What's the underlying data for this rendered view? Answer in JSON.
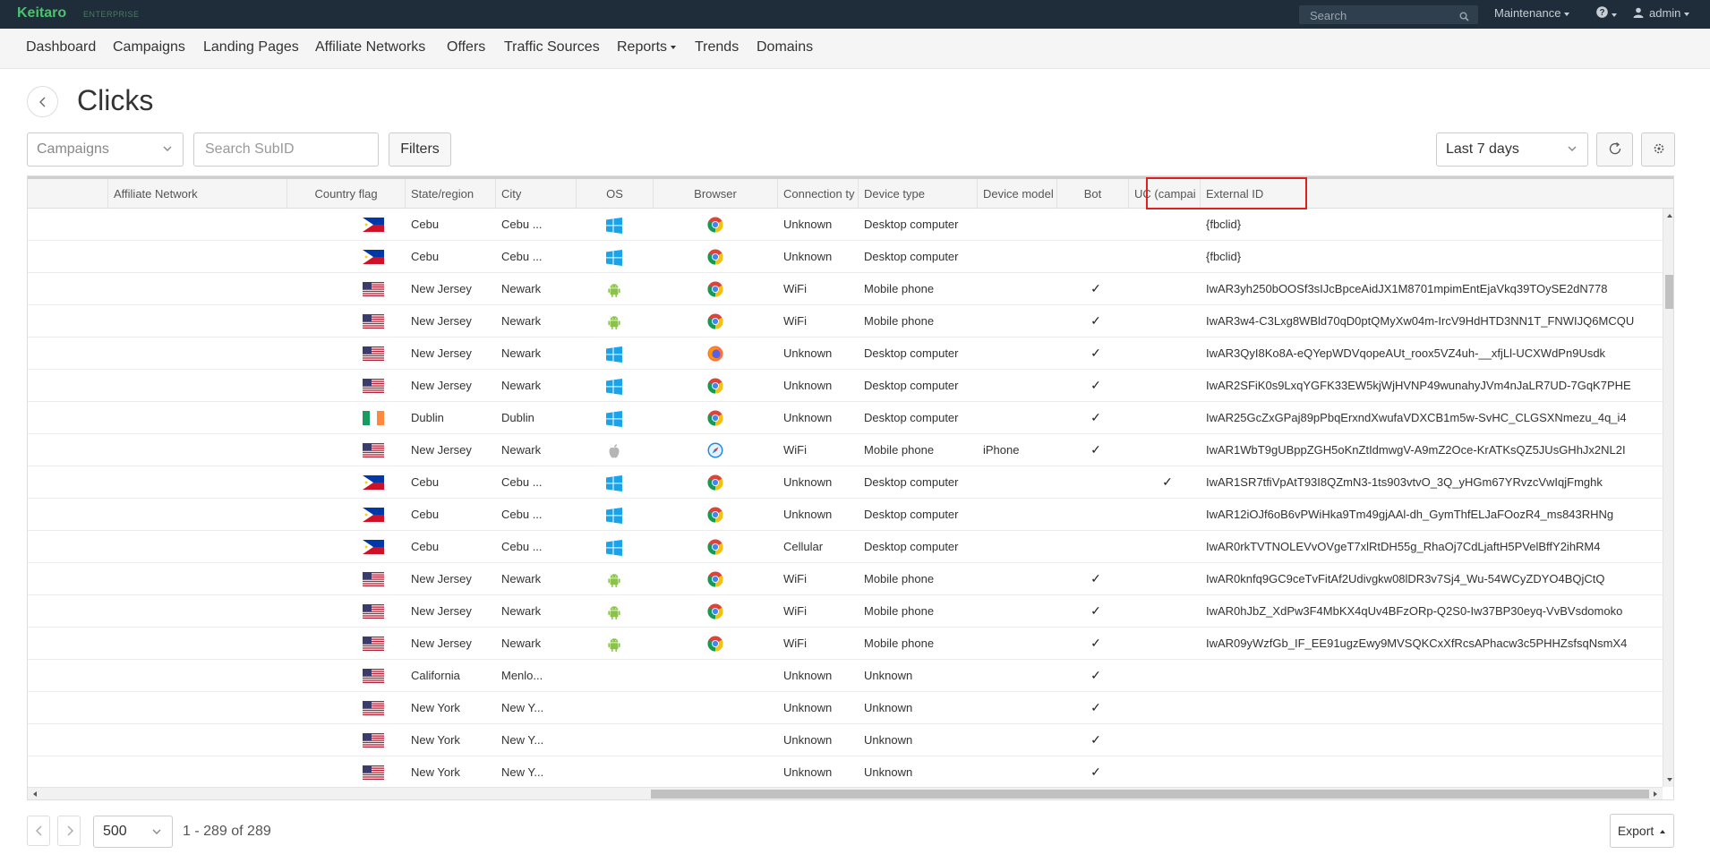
{
  "app": {
    "brand": "Keitaro",
    "edition": "ENTERPRISE",
    "search_placeholder": "Search",
    "maintenance_menu": "Maintenance",
    "user_menu": "admin"
  },
  "nav": {
    "dashboard": "Dashboard",
    "campaigns": "Campaigns",
    "landing_pages": "Landing Pages",
    "affiliate_networks": "Affiliate Networks",
    "offers": "Offers",
    "traffic_sources": "Traffic Sources",
    "reports": "Reports",
    "trends": "Trends",
    "domains": "Domains"
  },
  "page": {
    "title": "Clicks",
    "campaigns_select": "Campaigns",
    "subid_placeholder": "Search SubID",
    "filters_button": "Filters",
    "date_range": "Last 7 days"
  },
  "table": {
    "columns": {
      "affiliate_network": "Affiliate Network",
      "country_flag": "Country flag",
      "state": "State/region",
      "city": "City",
      "os": "OS",
      "browser": "Browser",
      "connection": "Connection ty",
      "device_type": "Device type",
      "device_model": "Device model",
      "bot": "Bot",
      "uc": "UC (campai",
      "external_id": "External ID"
    },
    "rows": [
      {
        "flag": "PH",
        "state": "Cebu",
        "city": "Cebu ...",
        "os": "windows",
        "browser": "chrome",
        "connection": "Unknown",
        "device_type": "Desktop computer",
        "device_model": "",
        "bot": false,
        "uc": false,
        "external_id": "{fbclid}"
      },
      {
        "flag": "PH",
        "state": "Cebu",
        "city": "Cebu ...",
        "os": "windows",
        "browser": "chrome",
        "connection": "Unknown",
        "device_type": "Desktop computer",
        "device_model": "",
        "bot": false,
        "uc": false,
        "external_id": "{fbclid}"
      },
      {
        "flag": "US",
        "state": "New Jersey",
        "city": "Newark",
        "os": "android",
        "browser": "chrome",
        "connection": "WiFi",
        "device_type": "Mobile phone",
        "device_model": "",
        "bot": true,
        "uc": false,
        "external_id": "IwAR3yh250bOOSf3sIJcBpceAidJX1M8701mpimEntEjaVkq39TOySE2dN778"
      },
      {
        "flag": "US",
        "state": "New Jersey",
        "city": "Newark",
        "os": "android",
        "browser": "chrome",
        "connection": "WiFi",
        "device_type": "Mobile phone",
        "device_model": "",
        "bot": true,
        "uc": false,
        "external_id": "IwAR3w4-C3Lxg8WBld70qD0ptQMyXw04m-IrcV9HdHTD3NN1T_FNWIJQ6MCQU"
      },
      {
        "flag": "US",
        "state": "New Jersey",
        "city": "Newark",
        "os": "windows",
        "browser": "firefox",
        "connection": "Unknown",
        "device_type": "Desktop computer",
        "device_model": "",
        "bot": true,
        "uc": false,
        "external_id": "IwAR3QyI8Ko8A-eQYepWDVqopeAUt_roox5VZ4uh-__xfjLl-UCXWdPn9Usdk"
      },
      {
        "flag": "US",
        "state": "New Jersey",
        "city": "Newark",
        "os": "windows",
        "browser": "chrome",
        "connection": "Unknown",
        "device_type": "Desktop computer",
        "device_model": "",
        "bot": true,
        "uc": false,
        "external_id": "IwAR2SFiK0s9LxqYGFK33EW5kjWjHVNP49wunahyJVm4nJaLR7UD-7GqK7PHE"
      },
      {
        "flag": "IE",
        "state": "Dublin",
        "city": "Dublin",
        "os": "windows",
        "browser": "chrome",
        "connection": "Unknown",
        "device_type": "Desktop computer",
        "device_model": "",
        "bot": true,
        "uc": false,
        "external_id": "IwAR25GcZxGPaj89pPbqErxndXwufaVDXCB1m5w-SvHC_CLGSXNmezu_4q_i4"
      },
      {
        "flag": "US",
        "state": "New Jersey",
        "city": "Newark",
        "os": "apple",
        "browser": "safari",
        "connection": "WiFi",
        "device_type": "Mobile phone",
        "device_model": "iPhone",
        "bot": true,
        "uc": false,
        "external_id": "IwAR1WbT9gUBppZGH5oKnZtIdmwgV-A9mZ2Oce-KrATKsQZ5JUsGHhJx2NL2I"
      },
      {
        "flag": "PH",
        "state": "Cebu",
        "city": "Cebu ...",
        "os": "windows",
        "browser": "chrome",
        "connection": "Unknown",
        "device_type": "Desktop computer",
        "device_model": "",
        "bot": false,
        "uc": true,
        "external_id": "IwAR1SR7tfiVpAtT93I8QZmN3-1ts903vtvO_3Q_yHGm67YRvzcVwIqjFmghk"
      },
      {
        "flag": "PH",
        "state": "Cebu",
        "city": "Cebu ...",
        "os": "windows",
        "browser": "chrome",
        "connection": "Unknown",
        "device_type": "Desktop computer",
        "device_model": "",
        "bot": false,
        "uc": false,
        "external_id": "IwAR12iOJf6oB6vPWiHka9Tm49gjAAl-dh_GymThfELJaFOozR4_ms843RHNg"
      },
      {
        "flag": "PH",
        "state": "Cebu",
        "city": "Cebu ...",
        "os": "windows",
        "browser": "chrome",
        "connection": "Cellular",
        "device_type": "Desktop computer",
        "device_model": "",
        "bot": false,
        "uc": false,
        "external_id": "IwAR0rkTVTNOLEVvOVgeT7xlRtDH55g_RhaOj7CdLjaftH5PVelBffY2ihRM4"
      },
      {
        "flag": "US",
        "state": "New Jersey",
        "city": "Newark",
        "os": "android",
        "browser": "chrome",
        "connection": "WiFi",
        "device_type": "Mobile phone",
        "device_model": "",
        "bot": true,
        "uc": false,
        "external_id": "IwAR0knfq9GC9ceTvFitAf2Udivgkw08lDR3v7Sj4_Wu-54WCyZDYO4BQjCtQ"
      },
      {
        "flag": "US",
        "state": "New Jersey",
        "city": "Newark",
        "os": "android",
        "browser": "chrome",
        "connection": "WiFi",
        "device_type": "Mobile phone",
        "device_model": "",
        "bot": true,
        "uc": false,
        "external_id": "IwAR0hJbZ_XdPw3F4MbKX4qUv4BFzORp-Q2S0-Iw37BP30eyq-VvBVsdomoko"
      },
      {
        "flag": "US",
        "state": "New Jersey",
        "city": "Newark",
        "os": "android",
        "browser": "chrome",
        "connection": "WiFi",
        "device_type": "Mobile phone",
        "device_model": "",
        "bot": true,
        "uc": false,
        "external_id": "IwAR09yWzfGb_IF_EE91ugzEwy9MVSQKCxXfRcsAPhacw3c5PHHZsfsqNsmX4"
      },
      {
        "flag": "US",
        "state": "California",
        "city": "Menlo...",
        "os": "",
        "browser": "",
        "connection": "Unknown",
        "device_type": "Unknown",
        "device_model": "",
        "bot": true,
        "uc": false,
        "external_id": ""
      },
      {
        "flag": "US",
        "state": "New York",
        "city": "New Y...",
        "os": "",
        "browser": "",
        "connection": "Unknown",
        "device_type": "Unknown",
        "device_model": "",
        "bot": true,
        "uc": false,
        "external_id": ""
      },
      {
        "flag": "US",
        "state": "New York",
        "city": "New Y...",
        "os": "",
        "browser": "",
        "connection": "Unknown",
        "device_type": "Unknown",
        "device_model": "",
        "bot": true,
        "uc": false,
        "external_id": ""
      },
      {
        "flag": "US",
        "state": "New York",
        "city": "New Y...",
        "os": "",
        "browser": "",
        "connection": "Unknown",
        "device_type": "Unknown",
        "device_model": "",
        "bot": true,
        "uc": false,
        "external_id": ""
      }
    ]
  },
  "footer": {
    "per_page": "500",
    "range": "1 - 289 of 289",
    "export_button": "Export"
  },
  "colors": {
    "topbar": "#1f2d3a",
    "brand": "#4cc26f",
    "highlight": "#e0201f"
  }
}
